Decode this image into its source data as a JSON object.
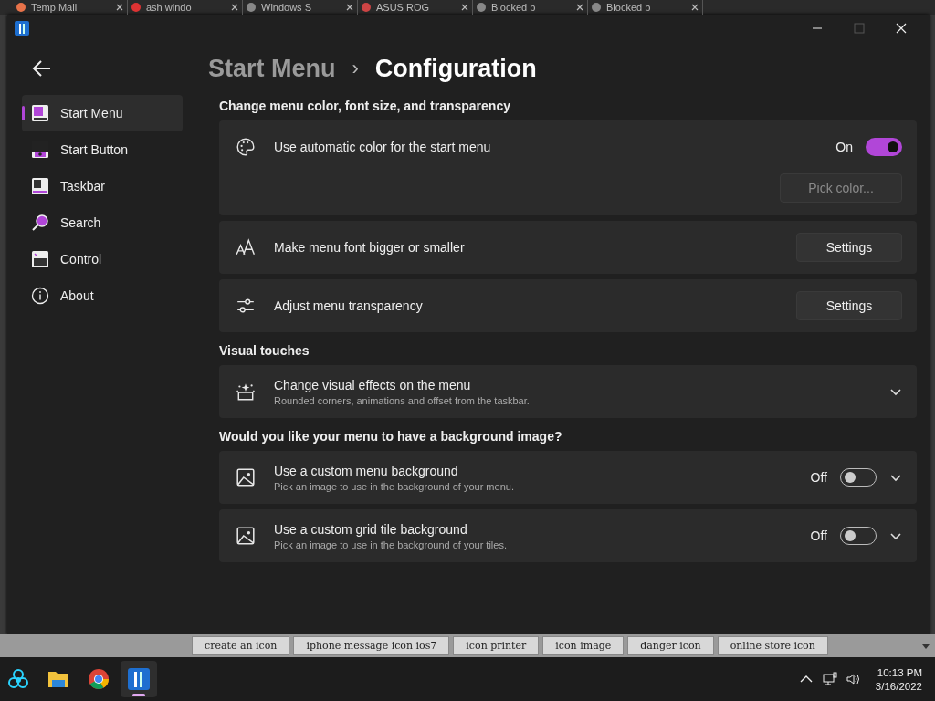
{
  "browser_tabs": [
    {
      "label": "Temp Mail"
    },
    {
      "label": "ash windo"
    },
    {
      "label": "Windows S"
    },
    {
      "label": "ASUS ROG"
    },
    {
      "label": "Blocked b"
    },
    {
      "label": "Blocked b"
    }
  ],
  "breadcrumb": {
    "parent": "Start Menu",
    "separator": "›",
    "current": "Configuration"
  },
  "sidebar": {
    "items": [
      {
        "label": "Start Menu",
        "selected": true
      },
      {
        "label": "Start Button",
        "selected": false
      },
      {
        "label": "Taskbar",
        "selected": false
      },
      {
        "label": "Search",
        "selected": false
      },
      {
        "label": "Control",
        "selected": false
      },
      {
        "label": "About",
        "selected": false
      }
    ]
  },
  "sections": [
    {
      "heading": "Change menu color, font size, and transparency",
      "cards": [
        {
          "title": "Use automatic color for the start menu",
          "toggle": {
            "on": true,
            "label": "On"
          },
          "button": {
            "label": "Pick color...",
            "disabled": true
          }
        },
        {
          "title": "Make menu font bigger or smaller",
          "button": {
            "label": "Settings",
            "disabled": false
          }
        },
        {
          "title": "Adjust menu transparency",
          "button": {
            "label": "Settings",
            "disabled": false
          }
        }
      ]
    },
    {
      "heading": "Visual touches",
      "cards": [
        {
          "title": "Change visual effects on the menu",
          "subtitle": "Rounded corners, animations and offset from the taskbar.",
          "expanded": false
        }
      ]
    },
    {
      "heading": "Would you like your menu to have a background image?",
      "cards": [
        {
          "title": "Use a custom menu background",
          "subtitle": "Pick an image to use in the background of your menu.",
          "toggle": {
            "on": false,
            "label": "Off"
          },
          "expanded": false
        },
        {
          "title": "Use a custom grid tile background",
          "subtitle": "Pick an image to use in the background of your tiles.",
          "toggle": {
            "on": false,
            "label": "Off"
          },
          "expanded": false
        }
      ]
    }
  ],
  "suggestions": [
    "create an icon",
    "iphone message icon ios7",
    "icon printer",
    "icon image",
    "danger icon",
    "online store icon"
  ],
  "taskbar": {
    "apps": [
      {
        "selected": false
      },
      {
        "selected": false
      },
      {
        "selected": false
      },
      {
        "selected": true
      }
    ],
    "time": "10:13 PM",
    "date": "3/16/2022"
  }
}
